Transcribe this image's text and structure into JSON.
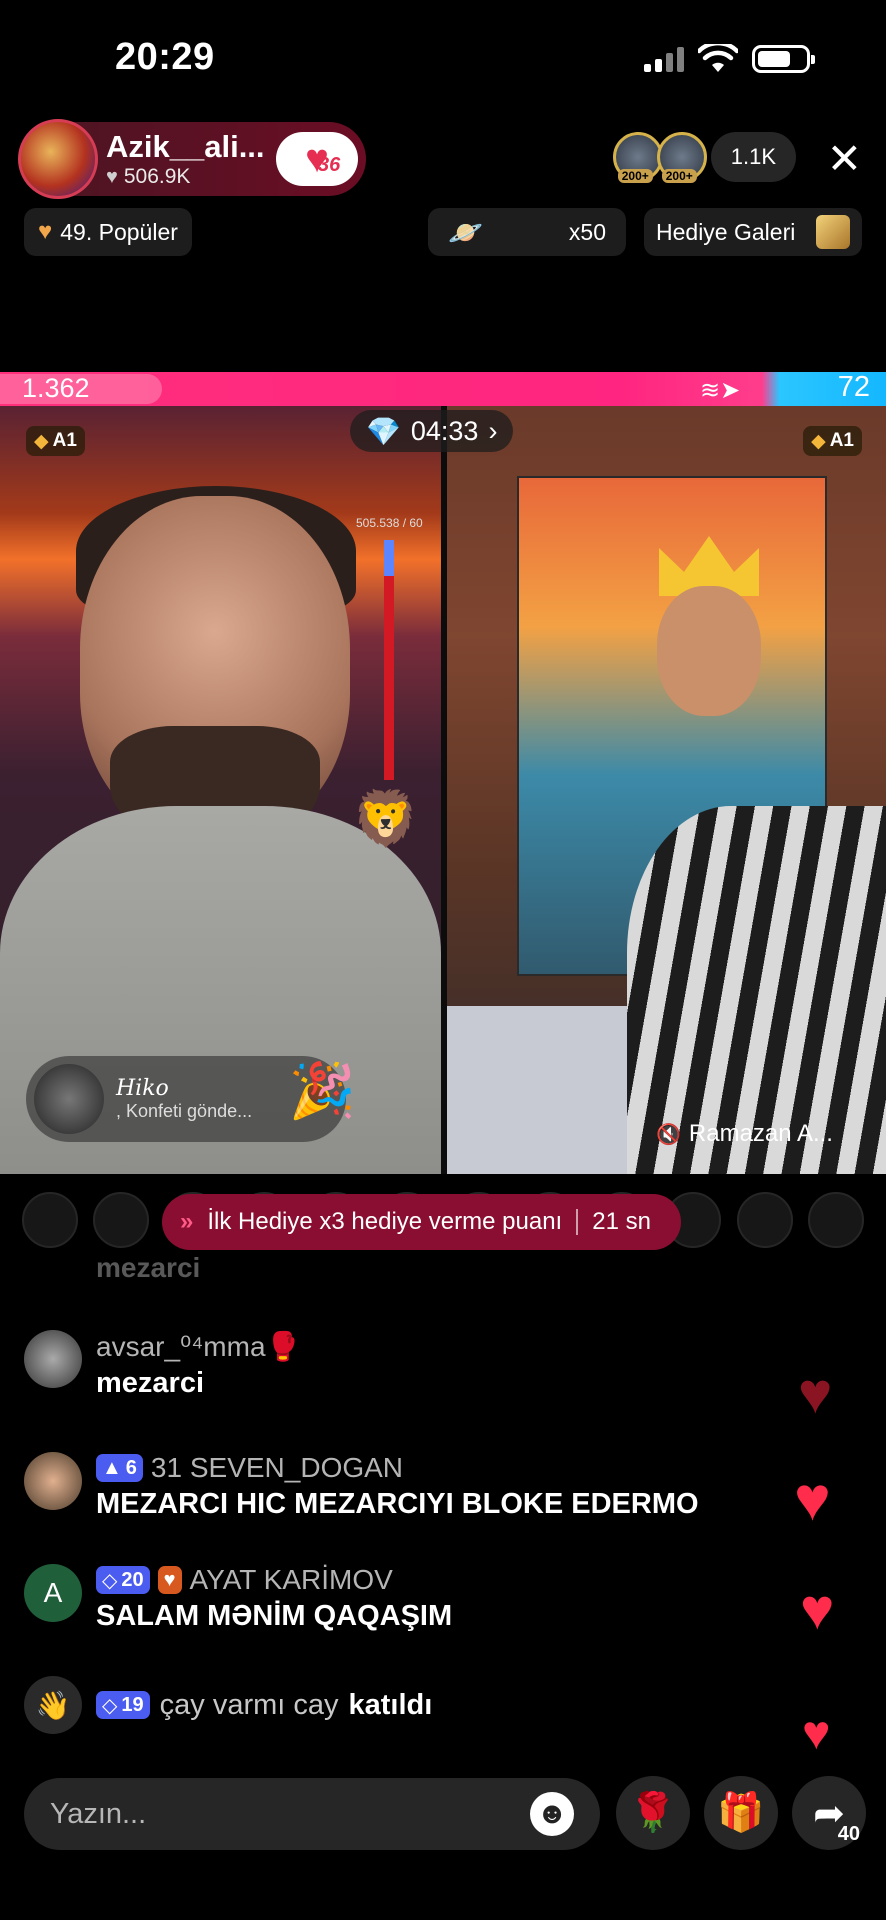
{
  "status": {
    "time": "20:29"
  },
  "host": {
    "name": "Azik__ali...",
    "likes": "506.9K",
    "badge_number": "36"
  },
  "viewers": {
    "avatar_badges": [
      "200+",
      "200+"
    ],
    "count": "1.1K"
  },
  "chips": {
    "popular": "49. Popüler",
    "multiplier": "x50",
    "gallery": "Hediye Galeri"
  },
  "battle": {
    "left_score": "1.362",
    "right_score": "72",
    "timer": "04:33",
    "left_badge": "A1",
    "right_badge": "A1",
    "hp_text": "505.538 / 60",
    "progress_fraction": 0.85
  },
  "gift_toast": {
    "user": "Hiko",
    "action": ", Konfeti gönde..."
  },
  "cohost": {
    "name": "Ramazan A..."
  },
  "promo": {
    "text": "İlk Hediye x3 hediye verme puanı",
    "time": "21 sn"
  },
  "ghost_comment": "mezarci",
  "comments": [
    {
      "user": "avsar_⁰⁴mma🥊",
      "text": "mezarci"
    },
    {
      "badge_level": "6",
      "user": "31 SEVEN_DOGAN",
      "text": "MEZARCI HIC MEZARCIYI BLOKE EDERMO"
    },
    {
      "avatar_letter": "A",
      "badge_level": "20",
      "user": "AYAT KARİMOV",
      "text": "SALAM MƏNİM QAQAŞIM"
    }
  ],
  "join": {
    "badge_level": "19",
    "user": "çay varmı cay",
    "action": "katıldı"
  },
  "input": {
    "placeholder": "Yazın..."
  },
  "share": {
    "count": "40"
  },
  "colors": {
    "accent_pink": "#ff2580",
    "accent_blue": "#14b7ff",
    "heart_red": "#ff2c4c"
  }
}
